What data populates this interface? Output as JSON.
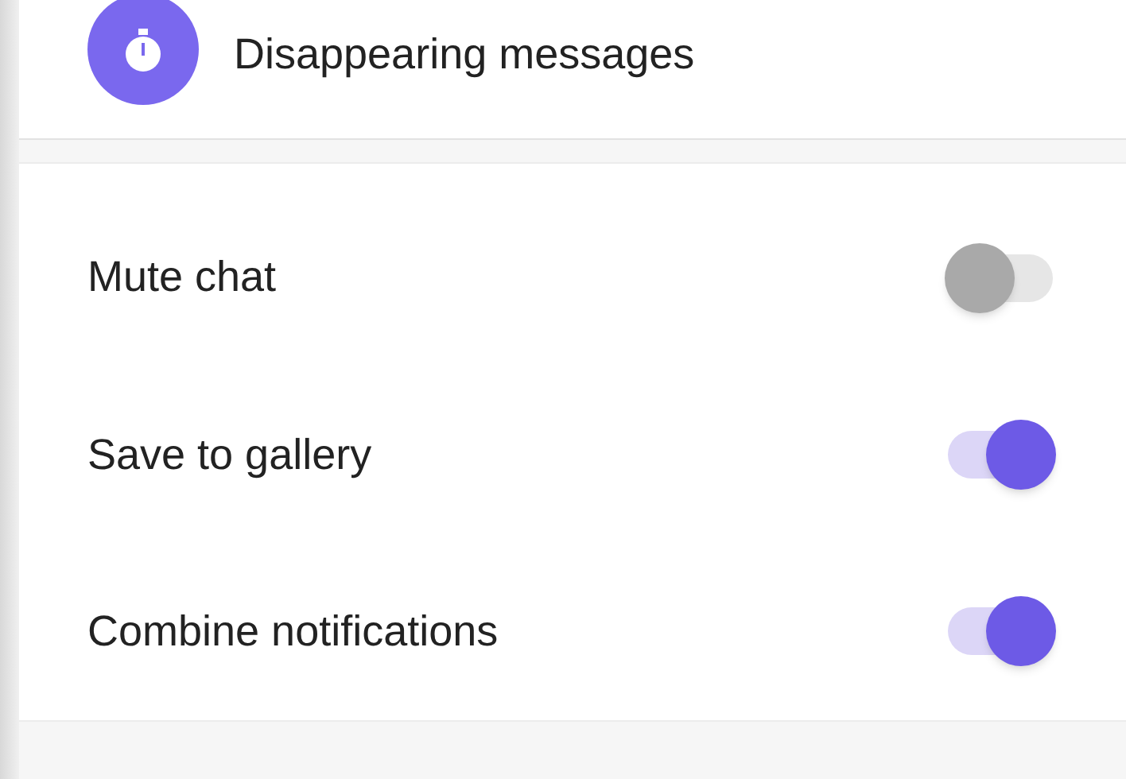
{
  "header_item": {
    "label": "Disappearing messages"
  },
  "settings": [
    {
      "label": "Mute chat",
      "on": false
    },
    {
      "label": "Save to gallery",
      "on": true
    },
    {
      "label": "Combine notifications",
      "on": true
    }
  ]
}
